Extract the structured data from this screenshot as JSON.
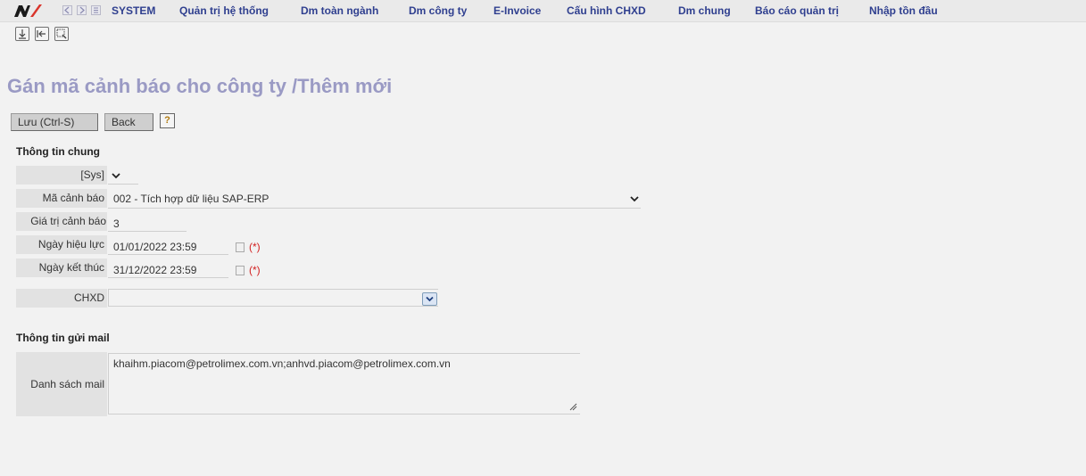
{
  "menu": {
    "items": [
      "SYSTEM",
      "Quản trị hệ thống",
      "Dm toàn ngành",
      "Dm công ty",
      "E-Invoice",
      "Cấu hình CHXD",
      "Dm chung",
      "Báo cáo quản trị",
      "Nhập tồn đầu"
    ]
  },
  "page": {
    "title": "Gán mã cảnh báo cho công ty /Thêm mới"
  },
  "buttons": {
    "save": "Lưu (Ctrl-S)",
    "back": "Back",
    "help": "?"
  },
  "general": {
    "title": "Thông tin chung",
    "sys_label": "[Sys]",
    "ma_canh_bao_label": "Mã cảnh báo",
    "ma_canh_bao_value": "002 - Tích hợp dữ liệu SAP-ERP",
    "gia_tri_label": "Giá trị cảnh báo",
    "gia_tri_value": "3",
    "ngay_hieu_luc_label": "Ngày hiệu lực",
    "ngay_hieu_luc_value": "01/01/2022 23:59",
    "ngay_ket_thuc_label": "Ngày kết thúc",
    "ngay_ket_thuc_value": "31/12/2022 23:59",
    "required_mark": "(*)",
    "chxd_label": "CHXD",
    "chxd_value": ""
  },
  "mail": {
    "title": "Thông tin gửi mail",
    "list_label": "Danh sách mail",
    "list_value": "khaihm.piacom@petrolimex.com.vn;anhvd.piacom@petrolimex.com.vn"
  },
  "colors": {
    "menu_text": "#2f3f8f",
    "title": "#9a9ac4",
    "required": "#d21f1f"
  }
}
